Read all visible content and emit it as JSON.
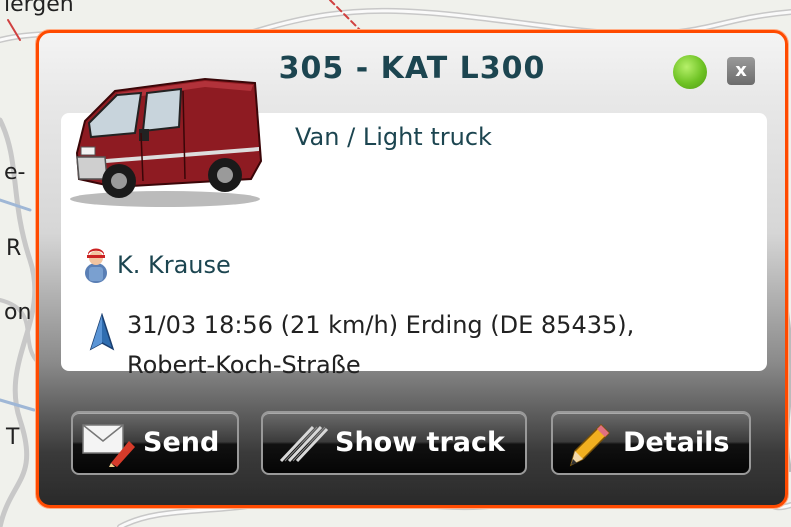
{
  "map": {
    "labels": [
      "lergen",
      "e-",
      "R",
      "on",
      "T"
    ]
  },
  "popup": {
    "title": "305 - KAT L300",
    "status_color": "#6ec224",
    "close_label": "x",
    "accent_color": "#ff4a00",
    "vehicle_type": "Van / Light truck",
    "driver": "K. Krause",
    "position_line1": "31/03 18:56 (21 km/h) Erding (DE 85435),",
    "position_line2": "Robert-Koch-Straße"
  },
  "buttons": {
    "send": "Send",
    "show_track": "Show track",
    "details": "Details"
  },
  "icons": {
    "vehicle": "van-icon",
    "driver": "person-icon",
    "position": "direction-arrow-icon",
    "send": "envelope-icon",
    "track": "track-lines-icon",
    "details": "pencil-icon"
  }
}
